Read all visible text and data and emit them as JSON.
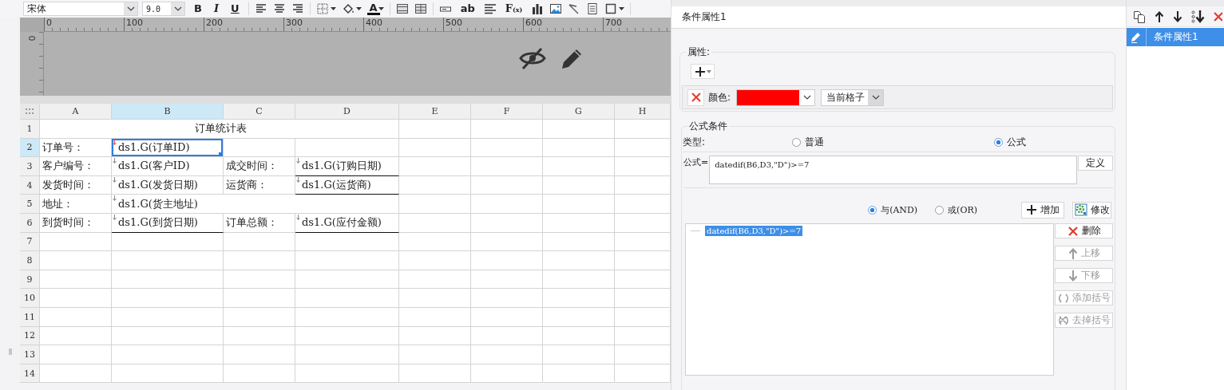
{
  "toolbar": {
    "font": "宋体",
    "font_size": "9.0",
    "items": [
      {
        "kind": "bold",
        "label": "B"
      },
      {
        "kind": "italic",
        "label": "I"
      },
      {
        "kind": "underline",
        "label": "U"
      },
      {
        "kind": "separator"
      },
      {
        "kind": "align-left"
      },
      {
        "kind": "align-center"
      },
      {
        "kind": "align-right"
      },
      {
        "kind": "separator"
      },
      {
        "kind": "borders"
      },
      {
        "kind": "fill-color"
      },
      {
        "kind": "font-color",
        "label": "A"
      },
      {
        "kind": "separator"
      },
      {
        "kind": "merge-cells"
      },
      {
        "kind": "split-cells"
      },
      {
        "kind": "separator"
      },
      {
        "kind": "input-box"
      },
      {
        "kind": "text",
        "label": "ab"
      },
      {
        "kind": "paragraph"
      },
      {
        "kind": "formula",
        "label": "F$_{(x)}$"
      },
      {
        "kind": "bar-chart"
      },
      {
        "kind": "image"
      },
      {
        "kind": "slash"
      },
      {
        "kind": "page"
      },
      {
        "kind": "frame"
      },
      {
        "kind": "separator"
      }
    ]
  },
  "ruler": {
    "marks": [
      "0",
      "100",
      "200",
      "300",
      "400",
      "500",
      "600",
      "700"
    ],
    "vertical_mark": "0"
  },
  "sheet": {
    "columns": [
      {
        "label": "A",
        "selected": false
      },
      {
        "label": "B",
        "selected": true
      },
      {
        "label": "C",
        "selected": false
      },
      {
        "label": "D",
        "selected": false
      },
      {
        "label": "E",
        "selected": false
      },
      {
        "label": "F",
        "selected": false
      },
      {
        "label": "G",
        "selected": false
      },
      {
        "label": "H",
        "selected": false
      }
    ],
    "rows": [
      {
        "label": "1",
        "selected": false,
        "cells": [
          {
            "kind": "title",
            "text": "订单统计表",
            "selected": false
          }
        ]
      },
      {
        "label": "2",
        "selected": true,
        "cells": [
          {
            "text": "订单号：",
            "selected": false
          },
          {
            "text": "ds1.G(订单ID)",
            "selected": true,
            "expand_marker": true
          }
        ]
      },
      {
        "label": "3",
        "selected": false,
        "cells": [
          {
            "text": "客户编号：",
            "selected": false
          },
          {
            "text": "ds1.G(客户ID)",
            "selected": false,
            "expand_marker": true
          },
          {
            "text": "成交时间：",
            "selected": false
          },
          {
            "text": "ds1.G(订购日期)",
            "selected": false,
            "expand_marker": true,
            "bottom_border": true
          }
        ]
      },
      {
        "label": "4",
        "selected": false,
        "cells": [
          {
            "text": "发货时间：",
            "selected": false
          },
          {
            "text": "ds1.G(发货日期)",
            "selected": false,
            "expand_marker": true
          },
          {
            "text": "运货商：",
            "selected": false
          },
          {
            "text": "ds1.G(运货商)",
            "selected": false,
            "expand_marker": true,
            "bottom_border": true
          }
        ]
      },
      {
        "label": "5",
        "selected": false,
        "cells": [
          {
            "text": "地址：",
            "selected": false
          },
          {
            "kind": "wide",
            "text": "ds1.G(货主地址)",
            "selected": false,
            "expand_marker": true
          }
        ]
      },
      {
        "label": "6",
        "selected": false,
        "cells": [
          {
            "text": "到货时间：",
            "selected": false
          },
          {
            "text": "ds1.G(到货日期)",
            "selected": false,
            "expand_marker": true,
            "bottom_border": true
          },
          {
            "text": "订单总额：",
            "selected": false
          },
          {
            "text": "ds1.G(应付金额)",
            "selected": false,
            "expand_marker": true,
            "bottom_border": true
          }
        ]
      },
      {
        "label": "7",
        "selected": false
      },
      {
        "label": "8",
        "selected": false
      },
      {
        "label": "9",
        "selected": false
      },
      {
        "label": "10",
        "selected": false
      },
      {
        "label": "11",
        "selected": false
      },
      {
        "label": "12",
        "selected": false
      },
      {
        "label": "13",
        "selected": false
      },
      {
        "label": "14",
        "selected": false
      }
    ]
  },
  "dialog": {
    "title": "条件属性1",
    "properties": {
      "heading": "属性:",
      "rows": [
        {
          "label": "颜色:",
          "color": "#ff0000",
          "scope": "当前格子"
        }
      ]
    },
    "formula_condition": {
      "heading": "公式条件",
      "type_label": "类型:",
      "types": [
        {
          "label": "普通",
          "selected": false
        },
        {
          "label": "公式",
          "selected": true
        }
      ],
      "formula_label": "公式=",
      "formula": "datedif(B6,D3,\"D\")>=7",
      "define_button": "定义",
      "logic": [
        {
          "label": "与(AND)",
          "selected": true
        },
        {
          "label": "或(OR)",
          "selected": false
        }
      ],
      "add_button": "增加",
      "edit_button": "修改",
      "conditions": [
        {
          "text": "datedif(B6,D3,\"D\")>=7",
          "selected": true
        }
      ],
      "actions": [
        {
          "kind": "delete",
          "label": "删除",
          "disabled": false
        },
        {
          "kind": "up",
          "label": "上移",
          "disabled": true
        },
        {
          "kind": "down",
          "label": "下移",
          "disabled": true
        },
        {
          "kind": "add-brackets",
          "label": "添加括号",
          "disabled": true
        },
        {
          "kind": "remove-brackets",
          "label": "去掉括号",
          "disabled": true
        }
      ]
    }
  },
  "condition_list": {
    "items": [
      {
        "label": "条件属性1",
        "selected": true
      }
    ]
  }
}
